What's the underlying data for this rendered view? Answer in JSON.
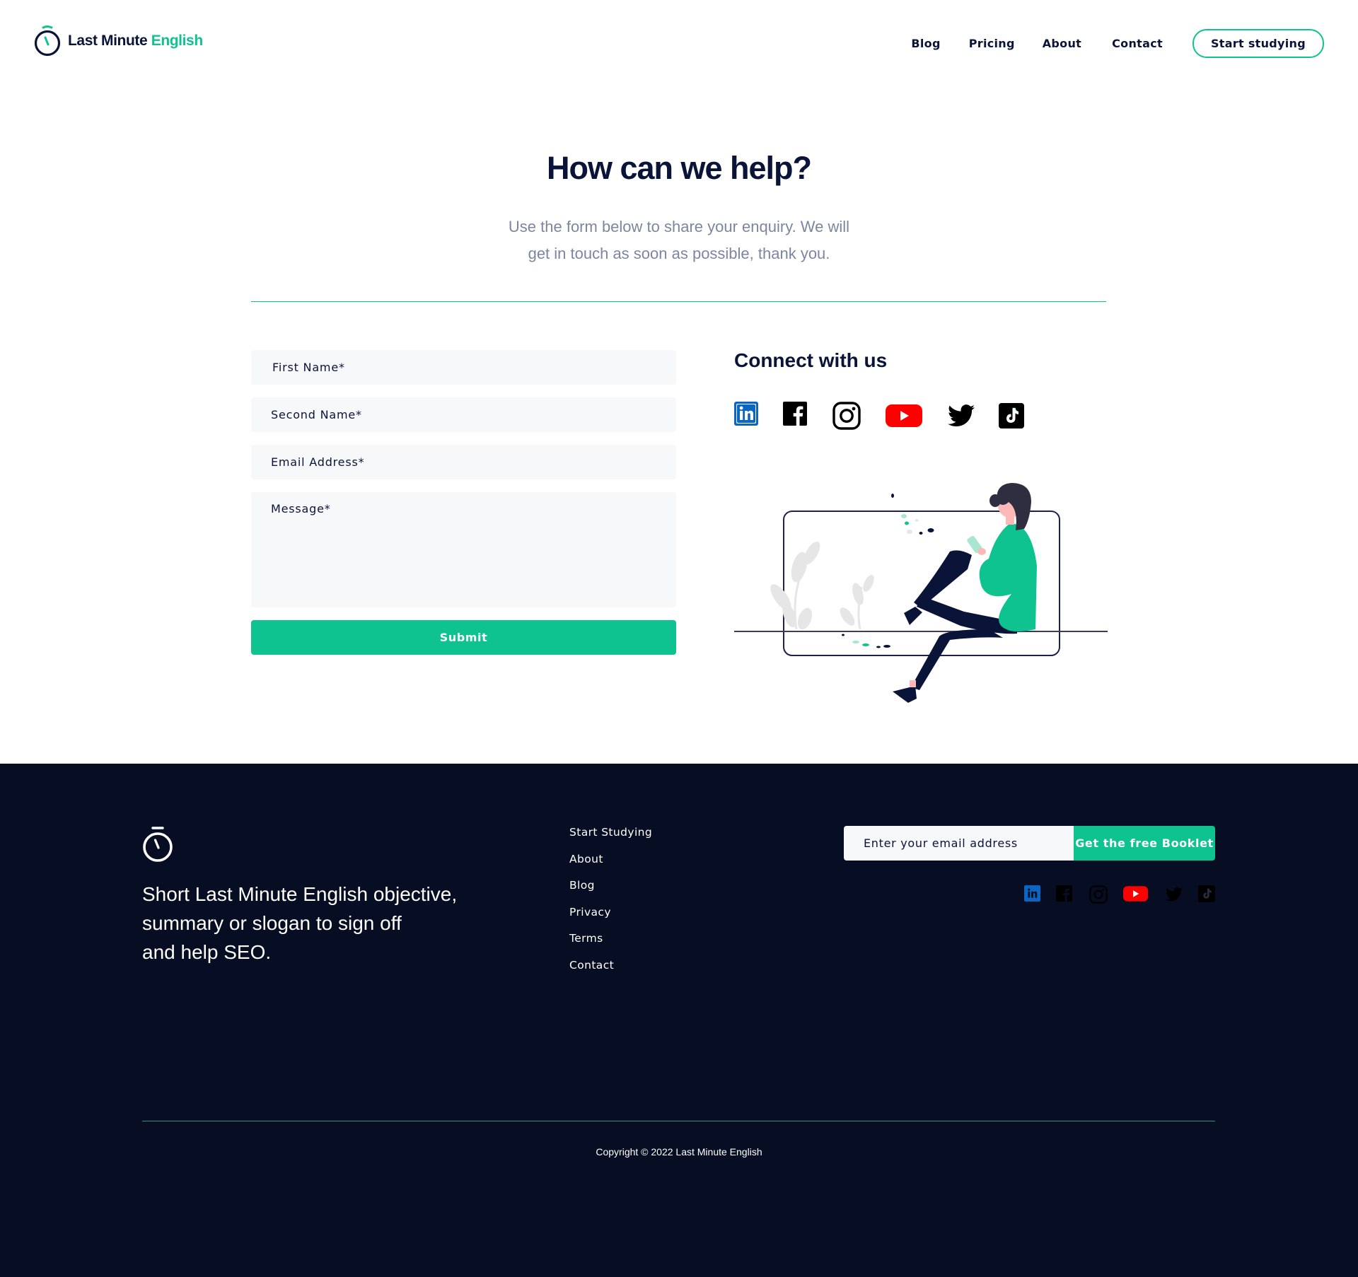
{
  "brand": {
    "name_part1": "Last Minute",
    "name_part2": "English",
    "accent_color": "#0ec38f",
    "navy_color": "#0a1438",
    "logo_icon": "stopwatch-icon"
  },
  "nav": {
    "items": [
      {
        "label": "Blog"
      },
      {
        "label": "Pricing"
      },
      {
        "label": "About"
      },
      {
        "label": "Contact"
      }
    ],
    "cta_label": "Start studying"
  },
  "hero": {
    "title": "How can we help?",
    "subtitle_line1": "Use the form below to share your enquiry. We will",
    "subtitle_line2": "get in touch as soon as possible, thank you."
  },
  "form": {
    "first_name_placeholder": "First Name*",
    "second_name_placeholder": "Second Name*",
    "email_placeholder": "Email Address*",
    "message_placeholder": "Message*",
    "submit_label": "Submit"
  },
  "connect": {
    "title": "Connect with us",
    "icons": [
      "linkedin-icon",
      "facebook-icon",
      "instagram-icon",
      "youtube-icon",
      "twitter-icon",
      "tiktok-icon"
    ]
  },
  "footer": {
    "slogan_line1": "Short Last Minute English objective,",
    "slogan_line2": "summary or slogan to sign off",
    "slogan_line3": "and help SEO.",
    "links": [
      {
        "label": "Start Studying"
      },
      {
        "label": "About"
      },
      {
        "label": "Blog"
      },
      {
        "label": "Privacy"
      },
      {
        "label": "Terms"
      },
      {
        "label": "Contact"
      }
    ],
    "newsletter_placeholder": "Enter your email address",
    "newsletter_button": "Get the free Booklet",
    "copyright": "Copyright © 2022 Last Minute English",
    "background_color": "#070d22"
  }
}
